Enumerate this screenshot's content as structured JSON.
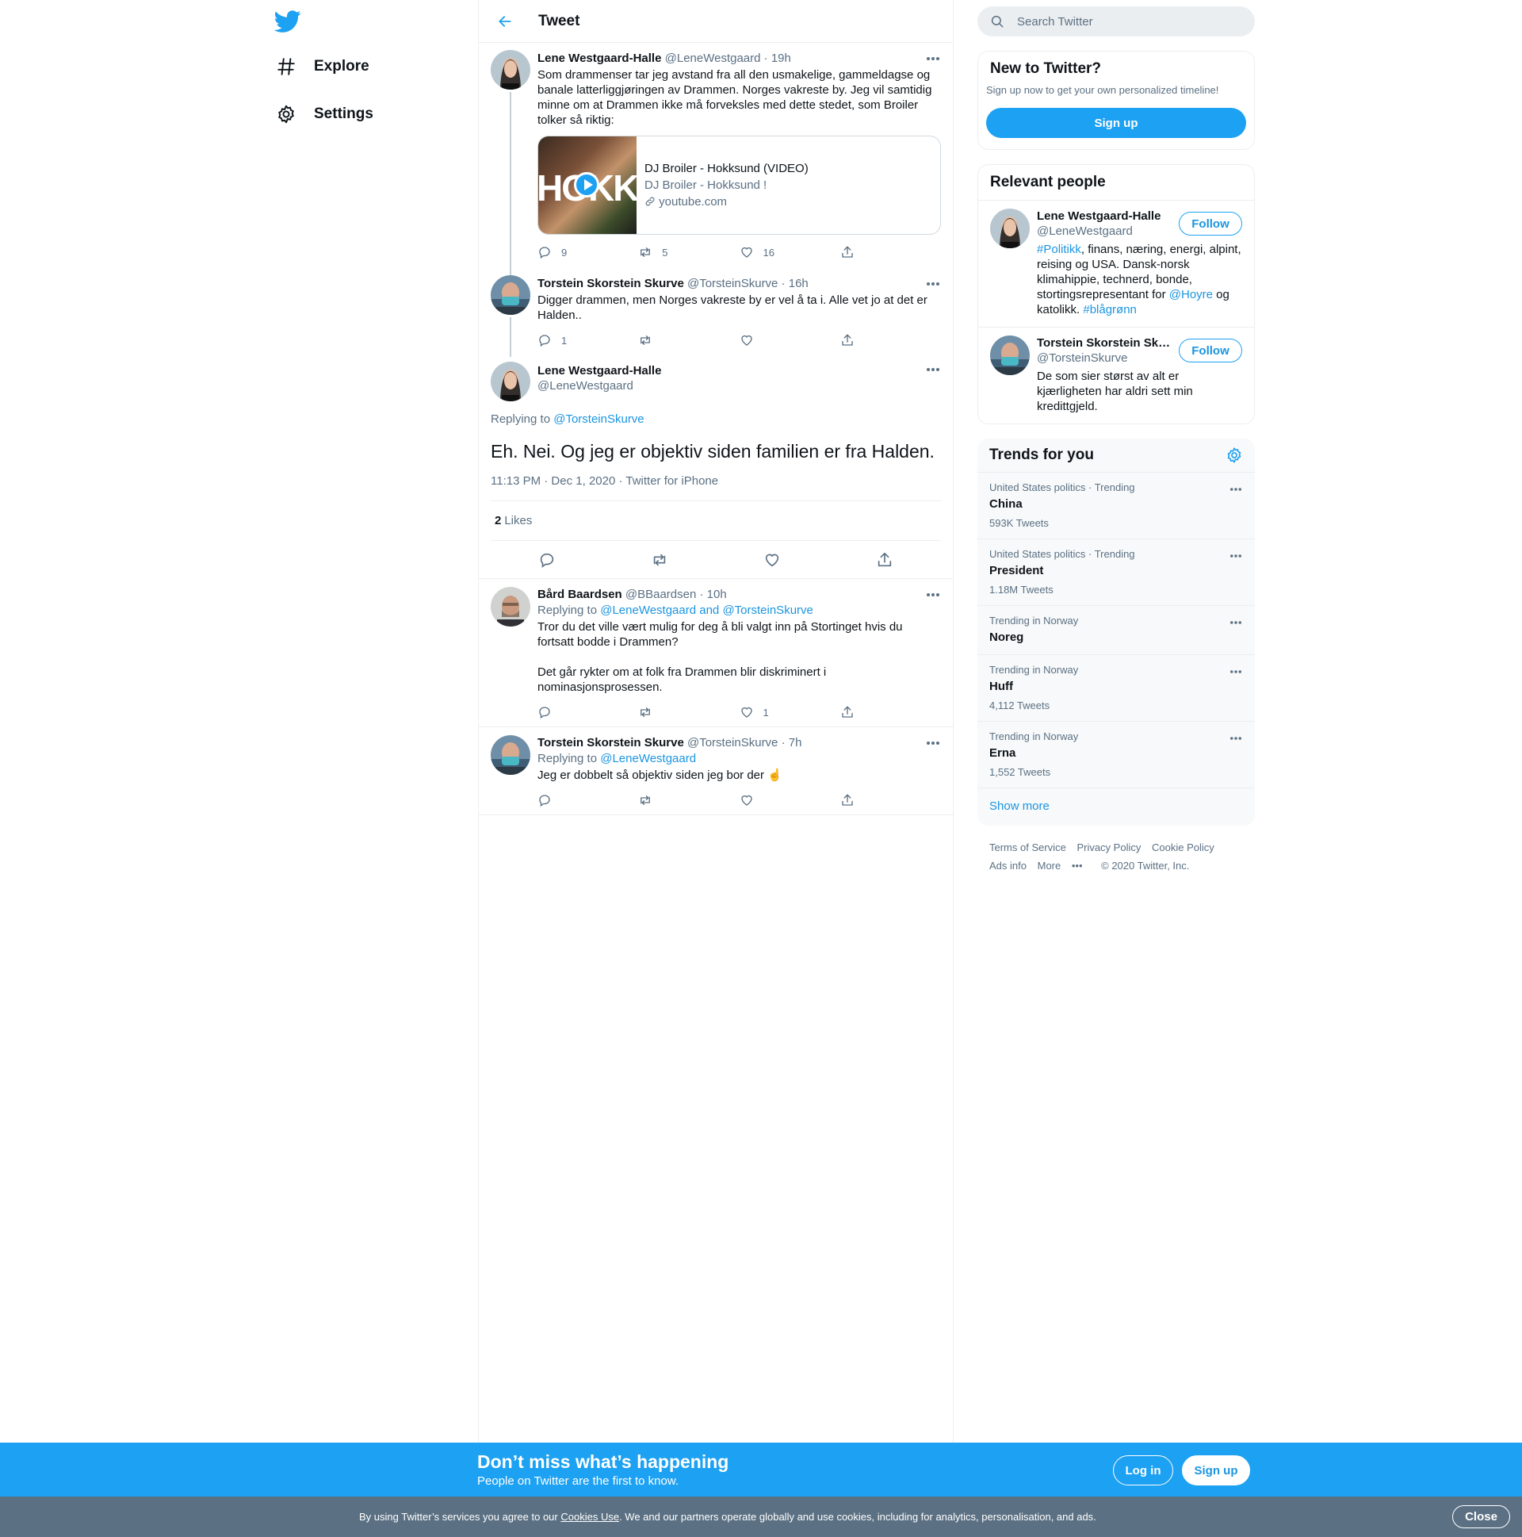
{
  "nav": {
    "explore": "Explore",
    "settings": "Settings"
  },
  "header": {
    "title": "Tweet"
  },
  "thread": [
    {
      "name": "Lene Westgaard-Halle",
      "handle": "@LeneWestgaard",
      "time": "· 19h",
      "text": "Som drammenser tar jeg avstand fra all den usmakelige, gammeldagse og banale latterliggjøringen av Drammen. Norges vakreste by. Jeg vil samtidig minne om at Drammen ikke må forveksles med dette stedet, som Broiler tolker så riktig:",
      "card": {
        "thumb_text": "HOKK",
        "title": "DJ Broiler - Hokksund (VIDEO)",
        "desc": "DJ Broiler - Hokksund !",
        "domain": "youtube.com"
      },
      "replies": "9",
      "retweets": "5",
      "likes": "16"
    },
    {
      "name": "Torstein Skorstein Skurve",
      "handle": "@TorsteinSkurve",
      "time": "· 16h",
      "text": "Digger drammen, men Norges vakreste by er vel å ta i. Alle vet jo at det er Halden..",
      "replies": "1",
      "retweets": "",
      "likes": ""
    }
  ],
  "focal": {
    "name": "Lene Westgaard-Halle",
    "handle": "@LeneWestgaard",
    "replying_prefix": "Replying to",
    "replying_to": "@TorsteinSkurve",
    "text": "Eh. Nei. Og jeg er objektiv siden familien er fra Halden.",
    "time": "11:13 PM · Dec 1, 2020",
    "source": "· Twitter for iPhone",
    "likes_count": "2",
    "likes_label": "Likes"
  },
  "replies": [
    {
      "name": "Bård Baardsen",
      "handle": "@BBaardsen",
      "time": "· 10h",
      "replying_prefix": "Replying to",
      "replying_to": "@LeneWestgaard and @TorsteinSkurve",
      "text1": "Tror du det ville vært mulig for deg å bli valgt inn på Stortinget hvis du fortsatt bodde i Drammen?",
      "text2": "Det går rykter om at folk fra Drammen blir diskriminert i nominasjonsprosessen.",
      "likes": "1"
    },
    {
      "name": "Torstein Skorstein Skurve",
      "handle": "@TorsteinSkurve",
      "time": "· 7h",
      "replying_prefix": "Replying to",
      "replying_to": "@LeneWestgaard",
      "text": "Jeg er dobbelt så objektiv siden jeg bor der",
      "emoji": "☝️"
    }
  ],
  "search": {
    "placeholder": "Search Twitter"
  },
  "new_to_twitter": {
    "title": "New to Twitter?",
    "text": "Sign up now to get your own personalized timeline!",
    "button": "Sign up"
  },
  "relevant_people": {
    "title": "Relevant people",
    "people": [
      {
        "name": "Lene Westgaard-Halle",
        "handle": "@LeneWestgaard",
        "bio_hashtag1": "#Politikk",
        "bio_part1": ", finans, næring, energi, alpint, reising og USA. Dansk-norsk klimahippie, technerd, bonde, stortingsrepresentant for ",
        "bio_mention": "@Hoyre",
        "bio_part2": " og katolikk. ",
        "bio_hashtag2": "#blågrønn",
        "follow": "Follow"
      },
      {
        "name": "Torstein Skorstein Skurve",
        "handle": "@TorsteinSkurve",
        "bio": "De som sier størst av alt er kjærligheten har aldri sett min kredittgjeld.",
        "follow": "Follow"
      }
    ]
  },
  "trends": {
    "title": "Trends for you",
    "items": [
      {
        "context": "United States politics · Trending",
        "name": "China",
        "count": "593K Tweets"
      },
      {
        "context": "United States politics · Trending",
        "name": "President",
        "count": "1.18M Tweets"
      },
      {
        "context": "Trending in Norway",
        "name": "Noreg",
        "count": ""
      },
      {
        "context": "Trending in Norway",
        "name": "Huff",
        "count": "4,112 Tweets"
      },
      {
        "context": "Trending in Norway",
        "name": "Erna",
        "count": "1,552 Tweets"
      }
    ],
    "show_more": "Show more"
  },
  "footer": {
    "terms": "Terms of Service",
    "privacy": "Privacy Policy",
    "cookie": "Cookie Policy",
    "ads": "Ads info",
    "more": "More",
    "copyright": "© 2020 Twitter, Inc."
  },
  "banner": {
    "title": "Don’t miss what’s happening",
    "subtitle": "People on Twitter are the first to know.",
    "login": "Log in",
    "signup": "Sign up"
  },
  "cookie_bar": {
    "prefix": "By using Twitter’s services you agree to our ",
    "link": "Cookies Use",
    "suffix": ". We and our partners operate globally and use cookies, including for analytics, personalisation, and ads.",
    "close": "Close"
  },
  "colors": {
    "accent": "#1da1f2",
    "link": "#1b95e0",
    "muted": "#5b7083",
    "border": "#ebeef0"
  }
}
